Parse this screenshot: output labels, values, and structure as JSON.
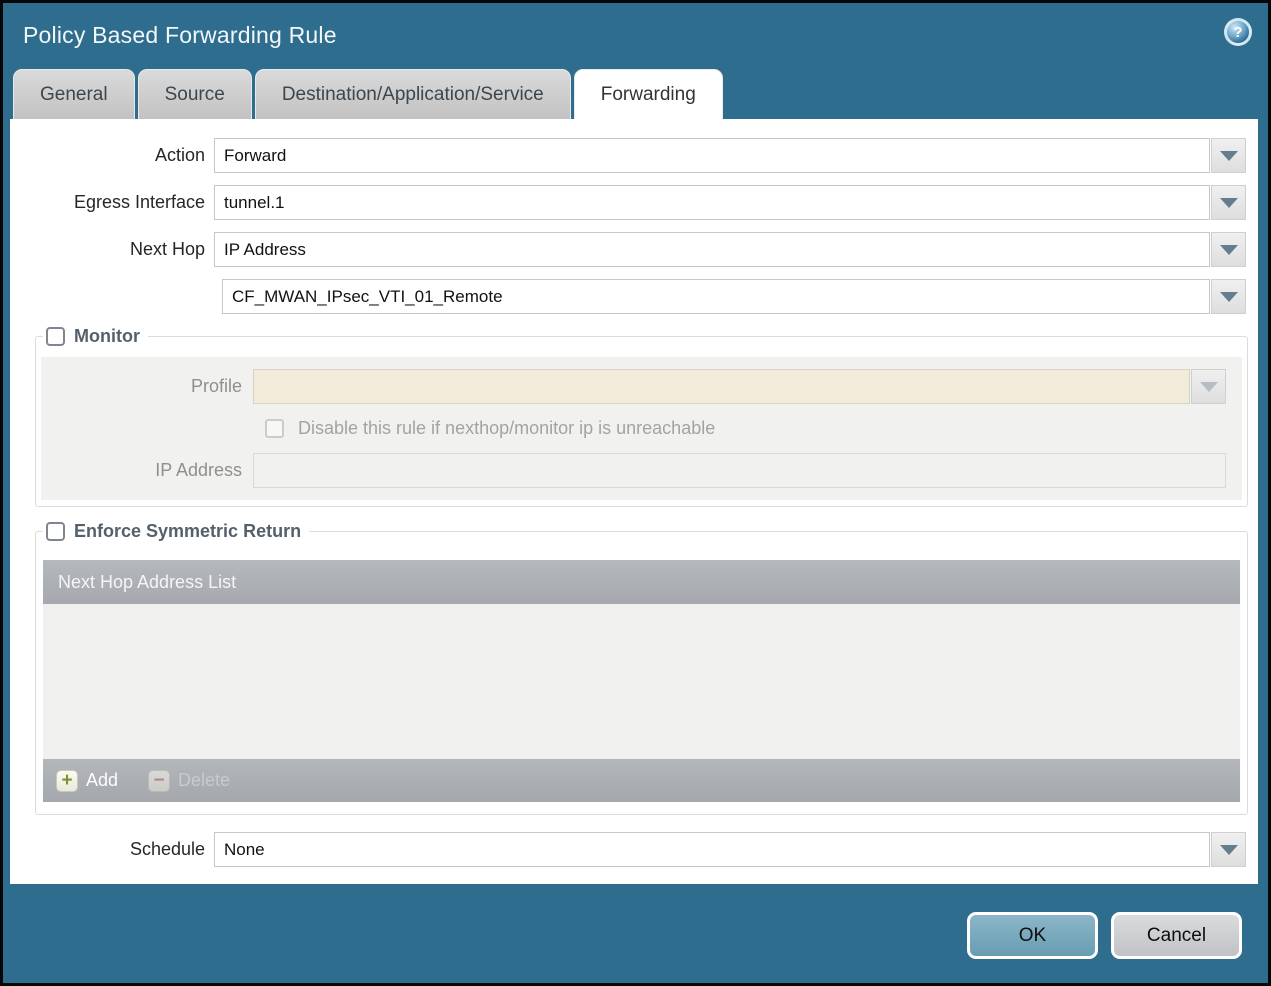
{
  "window": {
    "title": "Policy Based Forwarding Rule",
    "help_glyph": "?"
  },
  "tabs": [
    {
      "label": "General",
      "active": false
    },
    {
      "label": "Source",
      "active": false
    },
    {
      "label": "Destination/Application/Service",
      "active": false
    },
    {
      "label": "Forwarding",
      "active": true
    }
  ],
  "form": {
    "action": {
      "label": "Action",
      "value": "Forward"
    },
    "egress_interface": {
      "label": "Egress Interface",
      "value": "tunnel.1"
    },
    "next_hop": {
      "label": "Next Hop",
      "value": "IP Address"
    },
    "next_hop_address": {
      "value": "CF_MWAN_IPsec_VTI_01_Remote"
    },
    "schedule": {
      "label": "Schedule",
      "value": "None"
    }
  },
  "monitor": {
    "legend": "Monitor",
    "checked": false,
    "profile": {
      "label": "Profile",
      "value": ""
    },
    "disable_rule": {
      "label": "Disable this rule if nexthop/monitor ip is unreachable",
      "checked": false
    },
    "ip_address": {
      "label": "IP Address",
      "value": ""
    }
  },
  "symmetric_return": {
    "legend": "Enforce Symmetric Return",
    "checked": false,
    "table": {
      "header": "Next Hop Address List",
      "rows": []
    },
    "add_label": "Add",
    "add_glyph": "+",
    "delete_label": "Delete",
    "delete_glyph": "−"
  },
  "footer": {
    "ok_label": "OK",
    "cancel_label": "Cancel"
  },
  "colors": {
    "titlebar": "#2f6d8e",
    "panel": "#ffffff",
    "table_bar": "#aaaeb2",
    "disabled_panel": "#f1f1f0",
    "profile_disabled_bg": "#f3ebd9",
    "ok_button": "#74a8bd",
    "cancel_button": "#cbcdd0"
  }
}
